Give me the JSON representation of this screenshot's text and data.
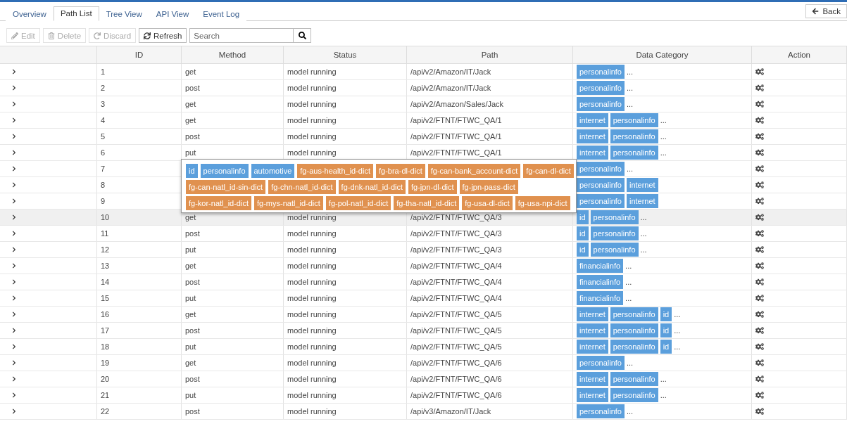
{
  "tabs": [
    {
      "label": "Overview",
      "selected": false
    },
    {
      "label": "Path List",
      "selected": true
    },
    {
      "label": "Tree View",
      "selected": false
    },
    {
      "label": "API View",
      "selected": false
    },
    {
      "label": "Event Log",
      "selected": false
    }
  ],
  "back_button": "Back",
  "toolbar": [
    {
      "label": "Edit",
      "kind": "edit",
      "disabled": true
    },
    {
      "label": "Delete",
      "kind": "delete",
      "disabled": true
    },
    {
      "label": "Discard",
      "kind": "discard",
      "disabled": true
    },
    {
      "label": "Refresh",
      "kind": "refresh",
      "disabled": false
    }
  ],
  "search": {
    "placeholder": "Search"
  },
  "table": {
    "columns": [
      "ID",
      "Method",
      "Status",
      "Path",
      "Data Category",
      "Action"
    ],
    "rows": [
      {
        "id": "1",
        "method": "get",
        "status": "model running",
        "path": "/api/v2/Amazon/IT/Jack",
        "tags": [
          "personalinfo"
        ],
        "more": "...",
        "selected": false
      },
      {
        "id": "2",
        "method": "post",
        "status": "model running",
        "path": "/api/v2/Amazon/IT/Jack",
        "tags": [
          "personalinfo"
        ],
        "more": "...",
        "selected": false
      },
      {
        "id": "3",
        "method": "get",
        "status": "model running",
        "path": "/api/v2/Amazon/Sales/Jack",
        "tags": [
          "personalinfo"
        ],
        "more": "...",
        "selected": false
      },
      {
        "id": "4",
        "method": "get",
        "status": "model running",
        "path": "/api/v2/FTNT/FTWC_QA/1",
        "tags": [
          "internet",
          "personalinfo"
        ],
        "more": "...",
        "selected": false
      },
      {
        "id": "5",
        "method": "post",
        "status": "model running",
        "path": "/api/v2/FTNT/FTWC_QA/1",
        "tags": [
          "internet",
          "personalinfo"
        ],
        "more": "...",
        "selected": false
      },
      {
        "id": "6",
        "method": "put",
        "status": "model running",
        "path": "/api/v2/FTNT/FTWC_QA/1",
        "tags": [
          "internet",
          "personalinfo"
        ],
        "more": "...",
        "selected": false
      },
      {
        "id": "7",
        "tags": [
          "personalinfo"
        ],
        "more": "...",
        "selected": false
      },
      {
        "id": "8",
        "tags": [
          "personalinfo",
          "internet"
        ],
        "selected": false
      },
      {
        "id": "9",
        "tags": [
          "personalinfo",
          "internet"
        ],
        "selected": false
      },
      {
        "id": "10",
        "method": "get",
        "status": "model running",
        "path": "/api/v2/FTNT/FTWC_QA/3",
        "tags": [
          "id",
          "personalinfo"
        ],
        "more": "...",
        "selected": true
      },
      {
        "id": "11",
        "method": "post",
        "status": "model running",
        "path": "/api/v2/FTNT/FTWC_QA/3",
        "tags": [
          "id",
          "personalinfo"
        ],
        "more": "...",
        "selected": false
      },
      {
        "id": "12",
        "method": "put",
        "status": "model running",
        "path": "/api/v2/FTNT/FTWC_QA/3",
        "tags": [
          "id",
          "personalinfo"
        ],
        "more": "...",
        "selected": false
      },
      {
        "id": "13",
        "method": "get",
        "status": "model running",
        "path": "/api/v2/FTNT/FTWC_QA/4",
        "tags": [
          "financialinfo"
        ],
        "more": "...",
        "selected": false
      },
      {
        "id": "14",
        "method": "post",
        "status": "model running",
        "path": "/api/v2/FTNT/FTWC_QA/4",
        "tags": [
          "financialinfo"
        ],
        "more": "...",
        "selected": false
      },
      {
        "id": "15",
        "method": "put",
        "status": "model running",
        "path": "/api/v2/FTNT/FTWC_QA/4",
        "tags": [
          "financialinfo"
        ],
        "more": "...",
        "selected": false
      },
      {
        "id": "16",
        "method": "get",
        "status": "model running",
        "path": "/api/v2/FTNT/FTWC_QA/5",
        "tags": [
          "internet",
          "personalinfo",
          "id"
        ],
        "more": "...",
        "selected": false
      },
      {
        "id": "17",
        "method": "post",
        "status": "model running",
        "path": "/api/v2/FTNT/FTWC_QA/5",
        "tags": [
          "internet",
          "personalinfo",
          "id"
        ],
        "more": "...",
        "selected": false
      },
      {
        "id": "18",
        "method": "put",
        "status": "model running",
        "path": "/api/v2/FTNT/FTWC_QA/5",
        "tags": [
          "internet",
          "personalinfo",
          "id"
        ],
        "more": "...",
        "selected": false
      },
      {
        "id": "19",
        "method": "get",
        "status": "model running",
        "path": "/api/v2/FTNT/FTWC_QA/6",
        "tags": [
          "personalinfo"
        ],
        "more": "...",
        "selected": false
      },
      {
        "id": "20",
        "method": "post",
        "status": "model running",
        "path": "/api/v2/FTNT/FTWC_QA/6",
        "tags": [
          "internet",
          "personalinfo"
        ],
        "more": "...",
        "selected": false
      },
      {
        "id": "21",
        "method": "put",
        "status": "model running",
        "path": "/api/v2/FTNT/FTWC_QA/6",
        "tags": [
          "internet",
          "personalinfo"
        ],
        "more": "...",
        "selected": false
      },
      {
        "id": "22",
        "method": "post",
        "status": "model running",
        "path": "/api/v3/Amazon/IT/Jack",
        "tags": [
          "personalinfo"
        ],
        "more": "...",
        "selected": false
      }
    ]
  },
  "popover": {
    "lines": [
      [
        {
          "label": "id",
          "color": "#5b9fdc"
        },
        {
          "label": "personalinfo",
          "color": "#5b9fdc"
        },
        {
          "label": "automotive",
          "color": "#5b9fdc"
        },
        {
          "label": "fg-aus-health_id-dict",
          "color": "#e0914f"
        },
        {
          "label": "fg-bra-dl-dict",
          "color": "#e0914f"
        },
        {
          "label": "fg-can-bank_account-dict",
          "color": "#e0914f"
        },
        {
          "label": "fg-can-dl-dict",
          "color": "#e0914f"
        }
      ],
      [
        {
          "label": "fg-can-natl_id-sin-dict",
          "color": "#e0914f"
        },
        {
          "label": "fg-chn-natl_id-dict",
          "color": "#e0914f"
        },
        {
          "label": "fg-dnk-natl_id-dict",
          "color": "#e0914f"
        },
        {
          "label": "fg-jpn-dl-dict",
          "color": "#e0914f"
        },
        {
          "label": "fg-jpn-pass-dict",
          "color": "#e0914f"
        }
      ],
      [
        {
          "label": "fg-kor-natl_id-dict",
          "color": "#e0914f"
        },
        {
          "label": "fg-mys-natl_id-dict",
          "color": "#e0914f"
        },
        {
          "label": "fg-pol-natl_id-dict",
          "color": "#e0914f"
        },
        {
          "label": "fg-tha-natl_id-dict",
          "color": "#e0914f"
        },
        {
          "label": "fg-usa-dl-dict",
          "color": "#e0914f"
        },
        {
          "label": "fg-usa-npi-dict",
          "color": "#e0914f"
        }
      ]
    ]
  }
}
